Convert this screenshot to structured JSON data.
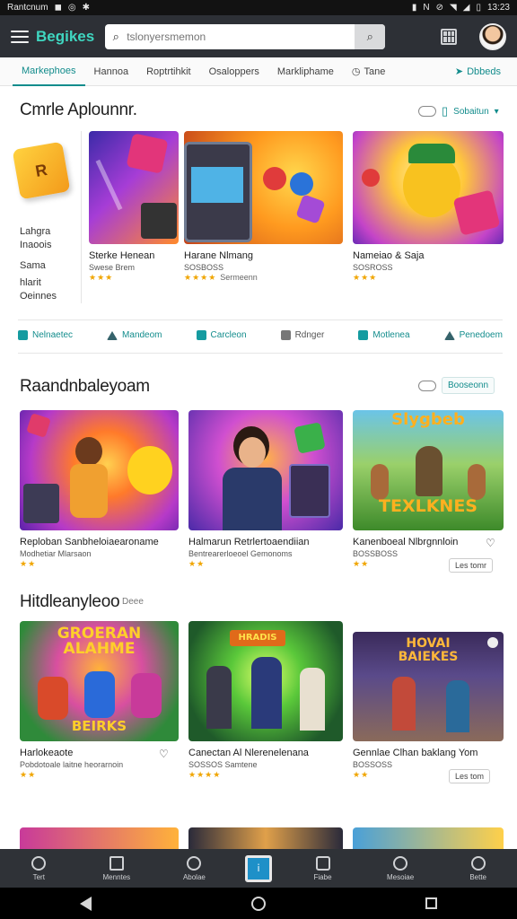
{
  "status": {
    "left_label": "Rantcnum",
    "time": "13:23"
  },
  "header": {
    "logo": "Begikes",
    "search": {
      "placeholder": "tslonyersmemon"
    }
  },
  "tabs": [
    {
      "label": "Markephoes",
      "active": true
    },
    {
      "label": "Hannoa"
    },
    {
      "label": "Roptrtihkit"
    },
    {
      "label": "Osaloppers"
    },
    {
      "label": "Markliphame"
    },
    {
      "label": "Tane"
    },
    {
      "label": "Dbbeds"
    }
  ],
  "section1": {
    "title": "Cmrle Aplounnr.",
    "control_label": "Sobaitun",
    "side_labels": [
      "Lahgra",
      "Inaoois",
      "Sama",
      "hlarit",
      "Oeinnes"
    ],
    "cards": [
      {
        "title": "Sterke Henean",
        "sub": "Swese Brem",
        "rating": "★★★",
        "rating_text": ""
      },
      {
        "title": "Harane Nlmang",
        "sub": "SOSBOSS",
        "rating": "★★★★",
        "rating_text": "Sermeenn"
      },
      {
        "title": "Nameiao & Saja",
        "sub": "SOSROSS",
        "rating": "★★★",
        "rating_text": ""
      }
    ]
  },
  "chips": [
    {
      "label": "Nelnaetec",
      "icon": "square-icon"
    },
    {
      "label": "Mandeom",
      "icon": "arrow-icon"
    },
    {
      "label": "Carcleon",
      "icon": "square-icon"
    },
    {
      "label": "Rdnger",
      "icon": "grey-square-icon"
    },
    {
      "label": "Motlenea",
      "icon": "square-icon"
    },
    {
      "label": "Penedoem",
      "icon": "arrow-icon"
    }
  ],
  "section2": {
    "title": "Raandnbaleyoam",
    "control_label": "Booseonn",
    "cards": [
      {
        "title": "Reploban Sanbheloiaearoname",
        "sub": "Modhetiar Mlarsaon",
        "rating": "★★",
        "button": ""
      },
      {
        "title": "Halmarun Retrlertoaendiian",
        "sub": "Bentrearerloeoel Gemonoms",
        "rating": "★★",
        "button": ""
      },
      {
        "title": "Kanenboeal Nlbrgnnloin",
        "sub": "BOSSBOSS",
        "rating": "★★",
        "button": "Les tomr"
      }
    ]
  },
  "section3": {
    "title": "Hitdleanyleoo",
    "subtitle": "Deee",
    "cards": [
      {
        "title": "Harlokeaote",
        "sub": "Pobdotoale laitne heorarnoin",
        "rating": "★★",
        "button": ""
      },
      {
        "title": "Canectan Al Nlerenelenana",
        "sub": "SOSSOS Samtene",
        "rating": "★★★★",
        "button": ""
      },
      {
        "title": "Gennlae Clhan baklang Yom",
        "sub": "BOSSOSS",
        "rating": "★★",
        "button": "Les tom"
      }
    ]
  },
  "bottom_nav": [
    {
      "label": "Tert",
      "icon": "circle-icon"
    },
    {
      "label": "Menntes",
      "icon": "home-icon"
    },
    {
      "label": "Abolae",
      "icon": "clock-icon"
    },
    {
      "label": "",
      "icon": "center-play-icon"
    },
    {
      "label": "Fiabe",
      "icon": "tv-icon"
    },
    {
      "label": "Mesoiae",
      "icon": "globe-icon"
    },
    {
      "label": "Bette",
      "icon": "user-icon"
    }
  ],
  "thumb_texts": {
    "s2c3": [
      "Slygbeb",
      "TEXLKNES"
    ],
    "s3c1": [
      "GROERAN",
      "ALAHME",
      "BEIRKS"
    ],
    "s3c2": [
      "HRADIS"
    ],
    "s3c3": [
      "HOVAI",
      "BAIEKES"
    ]
  }
}
